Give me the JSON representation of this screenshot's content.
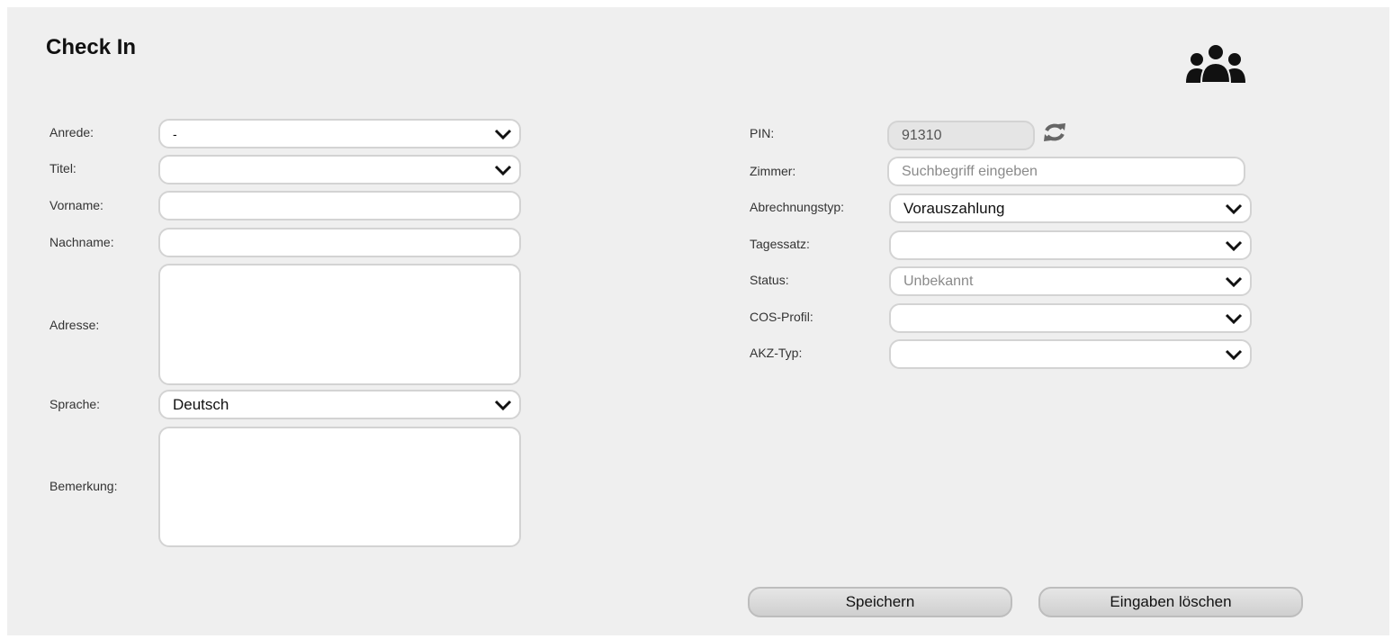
{
  "page": {
    "title": "Check In"
  },
  "left_form": {
    "anrede": {
      "label": "Anrede:",
      "value": "-"
    },
    "titel": {
      "label": "Titel:",
      "value": ""
    },
    "vorname": {
      "label": "Vorname:",
      "value": ""
    },
    "nachname": {
      "label": "Nachname:",
      "value": ""
    },
    "adresse": {
      "label": "Adresse:",
      "value": ""
    },
    "sprache": {
      "label": "Sprache:",
      "value": "Deutsch"
    },
    "bemerkung": {
      "label": "Bemerkung:",
      "value": ""
    }
  },
  "right_form": {
    "pin": {
      "label": "PIN:",
      "value": "91310"
    },
    "zimmer": {
      "label": "Zimmer:",
      "placeholder": "Suchbegriff eingeben"
    },
    "abrechnungstyp": {
      "label": "Abrechnungstyp:",
      "value": "Vorauszahlung"
    },
    "tagessatz": {
      "label": "Tagessatz:",
      "value": ""
    },
    "status": {
      "label": "Status:",
      "value": "Unbekannt"
    },
    "cos_profil": {
      "label": "COS-Profil:",
      "value": ""
    },
    "akz_typ": {
      "label": "AKZ-Typ:",
      "value": ""
    }
  },
  "actions": {
    "save_label": "Speichern",
    "clear_label": "Eingaben löschen"
  },
  "icons": {
    "header": "users-group-icon",
    "pin_refresh": "refresh-icon",
    "dropdown": "chevron-down-icon"
  }
}
